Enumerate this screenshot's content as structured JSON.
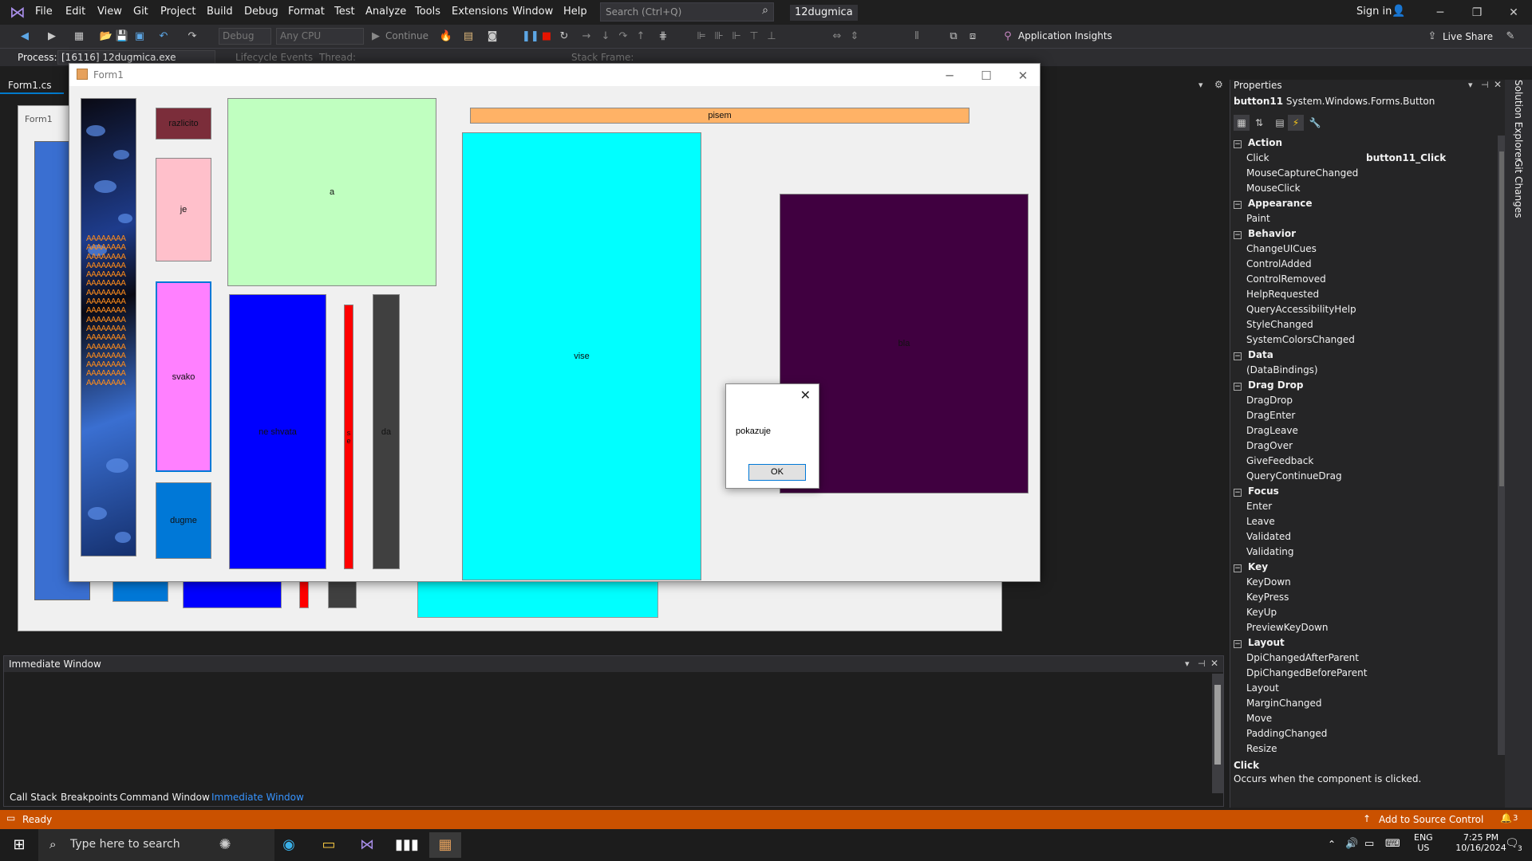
{
  "menubar": {
    "items": [
      "File",
      "Edit",
      "View",
      "Git",
      "Project",
      "Build",
      "Debug",
      "Format",
      "Test",
      "Analyze",
      "Tools",
      "Extensions",
      "Window",
      "Help"
    ],
    "search_placeholder": "Search (Ctrl+Q)",
    "solution_name": "12dugmica",
    "sign_in": "Sign in"
  },
  "toolbar": {
    "config": "Debug",
    "platform": "Any CPU",
    "continue": "Continue",
    "app_insights": "Application Insights",
    "live_share": "Live Share"
  },
  "debugbar": {
    "process_label": "Process:",
    "process_value": "[16116] 12dugmica.exe",
    "lifecycle": "Lifecycle Events",
    "thread_label": "Thread:",
    "stack_frame_label": "Stack Frame:"
  },
  "editor": {
    "doc_tab": "Form1.cs",
    "designer_form_title": "Form1"
  },
  "form1": {
    "title": "Form1",
    "buttons": {
      "razlicito": "razlicito",
      "je": "je",
      "a": "a",
      "pisem": "pisem",
      "svako": "svako",
      "ne_shvata": "ne shvata",
      "red_bar": "s\ne",
      "da": "da",
      "dugme": "dugme",
      "vise": "vise",
      "purple": "bla"
    },
    "image_text": "AAAAAAAA"
  },
  "msgbox": {
    "text": "pokazuje",
    "ok": "OK"
  },
  "properties": {
    "title": "Properties",
    "object": "button11",
    "object_type": "System.Windows.Forms.Button",
    "categories": [
      {
        "name": "Action",
        "rows": [
          {
            "name": "Click",
            "value": "button11_Click"
          },
          {
            "name": "MouseCaptureChanged",
            "value": ""
          },
          {
            "name": "MouseClick",
            "value": ""
          }
        ]
      },
      {
        "name": "Appearance",
        "rows": [
          {
            "name": "Paint",
            "value": ""
          }
        ]
      },
      {
        "name": "Behavior",
        "rows": [
          {
            "name": "ChangeUICues",
            "value": ""
          },
          {
            "name": "ControlAdded",
            "value": ""
          },
          {
            "name": "ControlRemoved",
            "value": ""
          },
          {
            "name": "HelpRequested",
            "value": ""
          },
          {
            "name": "QueryAccessibilityHelp",
            "value": ""
          },
          {
            "name": "StyleChanged",
            "value": ""
          },
          {
            "name": "SystemColorsChanged",
            "value": ""
          }
        ]
      },
      {
        "name": "Data",
        "rows": [
          {
            "name": "(DataBindings)",
            "value": ""
          }
        ]
      },
      {
        "name": "Drag Drop",
        "rows": [
          {
            "name": "DragDrop",
            "value": ""
          },
          {
            "name": "DragEnter",
            "value": ""
          },
          {
            "name": "DragLeave",
            "value": ""
          },
          {
            "name": "DragOver",
            "value": ""
          },
          {
            "name": "GiveFeedback",
            "value": ""
          },
          {
            "name": "QueryContinueDrag",
            "value": ""
          }
        ]
      },
      {
        "name": "Focus",
        "rows": [
          {
            "name": "Enter",
            "value": ""
          },
          {
            "name": "Leave",
            "value": ""
          },
          {
            "name": "Validated",
            "value": ""
          },
          {
            "name": "Validating",
            "value": ""
          }
        ]
      },
      {
        "name": "Key",
        "rows": [
          {
            "name": "KeyDown",
            "value": ""
          },
          {
            "name": "KeyPress",
            "value": ""
          },
          {
            "name": "KeyUp",
            "value": ""
          },
          {
            "name": "PreviewKeyDown",
            "value": ""
          }
        ]
      },
      {
        "name": "Layout",
        "rows": [
          {
            "name": "DpiChangedAfterParent",
            "value": ""
          },
          {
            "name": "DpiChangedBeforeParent",
            "value": ""
          },
          {
            "name": "Layout",
            "value": ""
          },
          {
            "name": "MarginChanged",
            "value": ""
          },
          {
            "name": "Move",
            "value": ""
          },
          {
            "name": "PaddingChanged",
            "value": ""
          },
          {
            "name": "Resize",
            "value": ""
          }
        ]
      }
    ],
    "desc_title": "Click",
    "desc_text": "Occurs when the component is clicked."
  },
  "side_tabs": [
    "Solution Explorer",
    "Git Changes"
  ],
  "immediate": {
    "title": "Immediate Window",
    "tabs": [
      "Call Stack",
      "Breakpoints",
      "Command Window",
      "Immediate Window"
    ]
  },
  "statusbar": {
    "ready": "Ready",
    "source_control": "Add to Source Control",
    "notifications": "3"
  },
  "taskbar": {
    "search_placeholder": "Type here to search",
    "lang1": "ENG",
    "lang2": "US",
    "time": "7:25 PM",
    "date": "10/16/2024",
    "notif_count": "3"
  },
  "colors": {
    "accent": "#007acc",
    "status": "#ca5100",
    "razlicito": "#7b2d3a",
    "je": "#ffc0cb",
    "a": "#c0ffc0",
    "pisem": "#ffb266",
    "svako": "#ff80ff",
    "ne_shvata": "#0000ff",
    "red_bar": "#ff0000",
    "da": "#404040",
    "dugme": "#0078d7",
    "vise": "#00ffff",
    "purple": "#400040"
  }
}
